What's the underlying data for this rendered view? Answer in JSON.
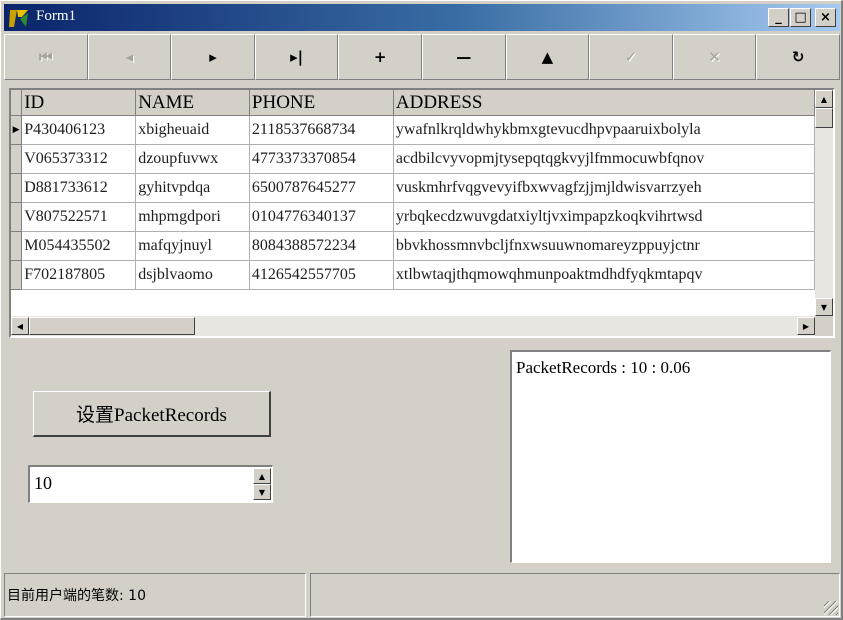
{
  "window": {
    "title": "Form1"
  },
  "caption_buttons": [
    {
      "name": "minimize-button",
      "glyph": "_"
    },
    {
      "name": "maximize-button",
      "glyph": "□"
    },
    {
      "name": "close-button",
      "glyph": "×"
    }
  ],
  "navigator": {
    "buttons": [
      {
        "name": "nav-first-button",
        "icon": "first-record-icon",
        "glyph": "⏮",
        "enabled": false
      },
      {
        "name": "nav-prior-button",
        "icon": "prior-record-icon",
        "glyph": "◂",
        "enabled": false
      },
      {
        "name": "nav-next-button",
        "icon": "next-record-icon",
        "glyph": "▸",
        "enabled": true
      },
      {
        "name": "nav-last-button",
        "icon": "last-record-icon",
        "glyph": "▸|",
        "enabled": true
      },
      {
        "name": "nav-insert-button",
        "icon": "plus-icon",
        "glyph": "+",
        "enabled": true
      },
      {
        "name": "nav-delete-button",
        "icon": "minus-icon",
        "glyph": "—",
        "enabled": true
      },
      {
        "name": "nav-edit-button",
        "icon": "up-triangle-icon",
        "glyph": "▲",
        "enabled": true
      },
      {
        "name": "nav-post-button",
        "icon": "checkmark-icon",
        "glyph": "✓",
        "enabled": false
      },
      {
        "name": "nav-cancel-button",
        "icon": "x-icon",
        "glyph": "✕",
        "enabled": false
      },
      {
        "name": "nav-refresh-button",
        "icon": "refresh-icon",
        "glyph": "↻",
        "enabled": true
      }
    ]
  },
  "grid": {
    "columns": [
      "ID",
      "NAME",
      "PHONE",
      "ADDRESS"
    ],
    "current_row_indicator": "▶",
    "rows": [
      [
        "P430406123",
        "xbigheuaid",
        "2118537668734",
        "ywafnlkrqldwhykbmxgtevucdhpvpaaruixbolyla"
      ],
      [
        "V065373312",
        "dzoupfuvwx",
        "4773373370854",
        "acdbilcvyvopmjtysepqtqgkvyjlfmmocuwbfqnov"
      ],
      [
        "D881733612",
        "gyhitvpdqa",
        "6500787645277",
        "vuskmhrfvqgvevyifbxwvagfzjjmjldwisvarrzyeh"
      ],
      [
        "V807522571",
        "mhpmgdpori",
        "0104776340137",
        "yrbqkecdzwuvgdatxiyltjvximpapzkoqkvihrtwsd"
      ],
      [
        "M054435502",
        "mafqyjnuyl",
        "8084388572234",
        "bbvkhossmnvbcljfnxwsuuwnomareyzppuyjctnr"
      ],
      [
        "F702187805",
        "dsjblvaomo",
        "4126542557705",
        "xtlbwtaqjthqmowqhmunpoaktmdhdfyqkmtapqv"
      ]
    ]
  },
  "controls": {
    "set_button_label": "设置PacketRecords",
    "spin_value": "10"
  },
  "memo": {
    "text": "PacketRecords : 10 : 0.06"
  },
  "statusbar": {
    "panel1": "目前用户端的笔数:  10",
    "panel2": ""
  }
}
